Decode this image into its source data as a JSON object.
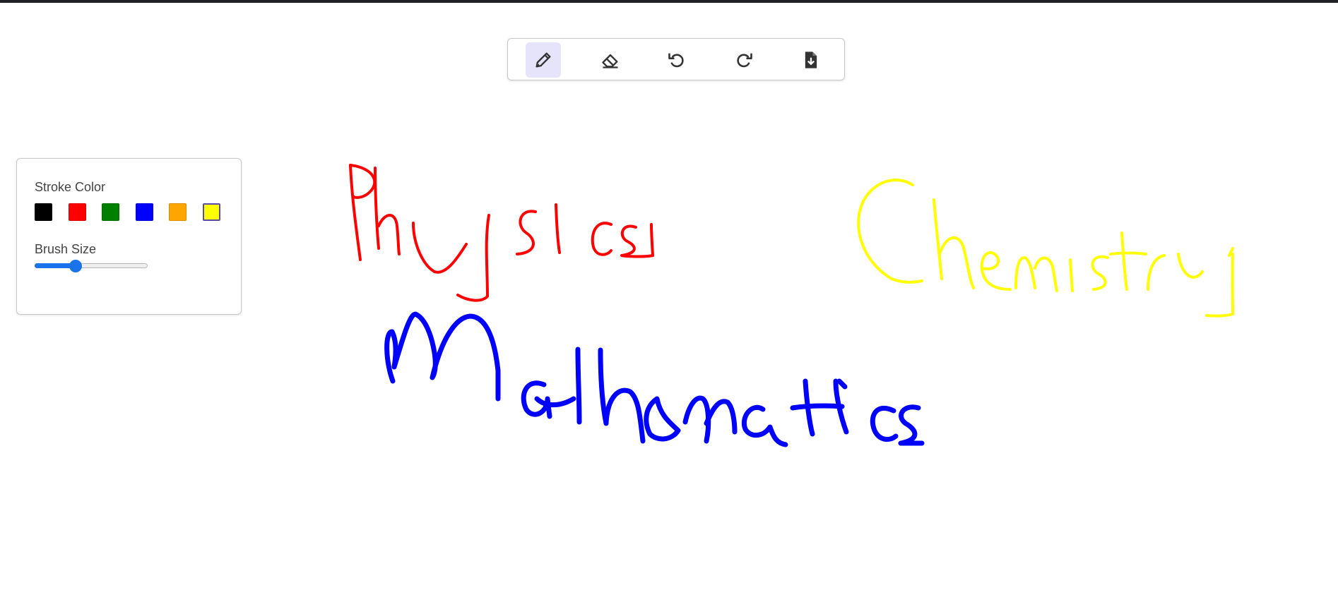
{
  "toolbar": {
    "tools": [
      {
        "name": "pen",
        "icon": "pencil-icon",
        "active": true
      },
      {
        "name": "eraser",
        "icon": "eraser-icon",
        "active": false
      },
      {
        "name": "undo",
        "icon": "undo-icon",
        "active": false
      },
      {
        "name": "redo",
        "icon": "redo-icon",
        "active": false
      },
      {
        "name": "download",
        "icon": "file-download-icon",
        "active": false
      }
    ]
  },
  "panel": {
    "stroke_color_label": "Stroke Color",
    "brush_size_label": "Brush Size",
    "colors": [
      "#000000",
      "#ff0000",
      "#008000",
      "#0000ff",
      "#ffa500",
      "#ffff00"
    ],
    "selected_color": "#ffff00",
    "brush_size_fraction": 0.36
  },
  "drawing": {
    "words": [
      {
        "text": "Physics",
        "color": "#ff0000"
      },
      {
        "text": "Chemistry",
        "color": "#ffff00"
      },
      {
        "text": "Mathematics",
        "color": "#0000ff"
      }
    ]
  }
}
